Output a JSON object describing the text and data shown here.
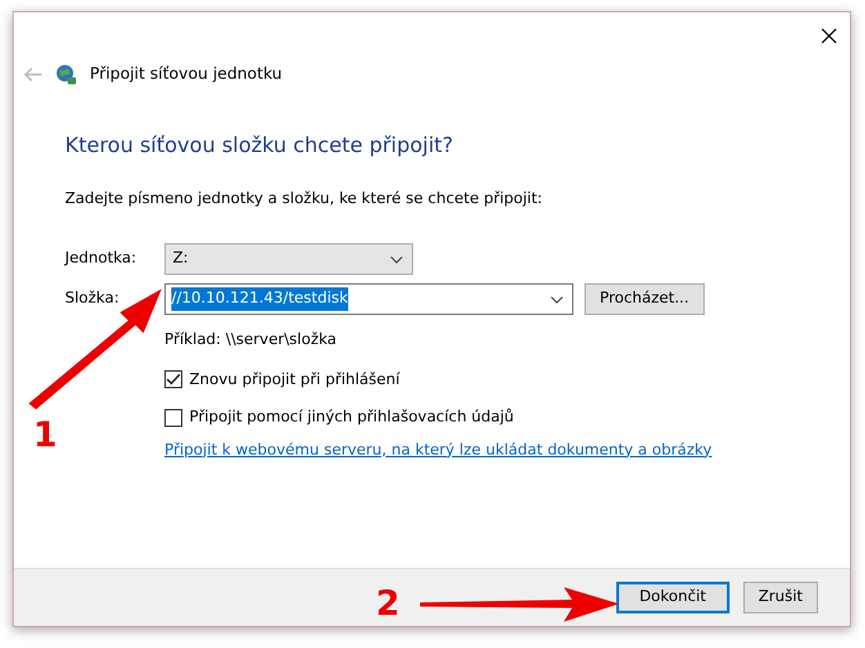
{
  "window": {
    "title": "Připojit síťovou jednotku"
  },
  "heading": "Kterou síťovou složku chcete připojit?",
  "instruction": "Zadejte písmeno jednotky a složku, ke které se chcete připojit:",
  "drive": {
    "label": "Jednotka:",
    "value": "Z:"
  },
  "folder": {
    "label": "Složka:",
    "value": "//10.10.121.43/testdisk",
    "selected": true
  },
  "browse_button": "Procházet...",
  "example": "Příklad: \\\\server\\složka",
  "checkboxes": [
    {
      "label": "Znovu připojit při přihlášení",
      "checked": true
    },
    {
      "label": "Připojit pomocí jiných přihlašovacích údajů",
      "checked": false
    }
  ],
  "link": "Připojit k webovému serveru, na který lze ukládat dokumenty a obrázky",
  "buttons": [
    {
      "label": "Dokončit",
      "default": true
    },
    {
      "label": "Zrušit",
      "default": false
    }
  ],
  "annotations": [
    {
      "number": "1"
    },
    {
      "number": "2"
    }
  ]
}
